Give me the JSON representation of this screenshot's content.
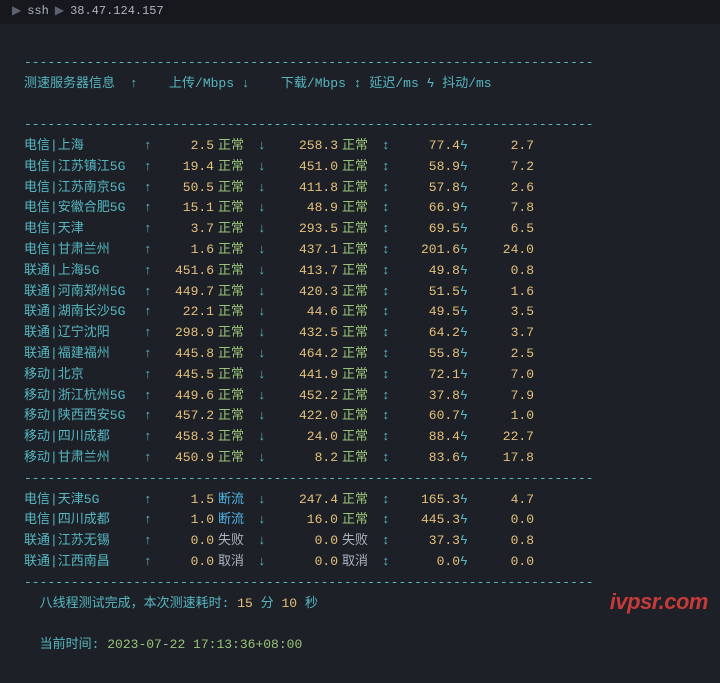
{
  "breadcrumb": {
    "a": "ssh",
    "b": "38.47.124.157",
    "arrow": "▶"
  },
  "divider": "-------------------------------------------------------------------------",
  "header": {
    "server": "测速服务器信息",
    "up": "上传/Mbps",
    "down": "下载/Mbps",
    "latency": "延迟/ms",
    "jitter": "抖动/ms",
    "i_up": "↑",
    "i_dn": "↓",
    "i_ud": "↕",
    "i_spark": "ϟ"
  },
  "icons": {
    "up": "↑",
    "dn": "↓",
    "ud": "↕",
    "spark": "ϟ"
  },
  "rows_main": [
    {
      "srv": "电信|上海",
      "up": "2.5",
      "s1": "正常",
      "dn": "258.3",
      "s2": "正常",
      "lat": "77.4",
      "jit": "2.7"
    },
    {
      "srv": "电信|江苏镇江5G",
      "up": "19.4",
      "s1": "正常",
      "dn": "451.0",
      "s2": "正常",
      "lat": "58.9",
      "jit": "7.2"
    },
    {
      "srv": "电信|江苏南京5G",
      "up": "50.5",
      "s1": "正常",
      "dn": "411.8",
      "s2": "正常",
      "lat": "57.8",
      "jit": "2.6"
    },
    {
      "srv": "电信|安徽合肥5G",
      "up": "15.1",
      "s1": "正常",
      "dn": "48.9",
      "s2": "正常",
      "lat": "66.9",
      "jit": "7.8"
    },
    {
      "srv": "电信|天津",
      "up": "3.7",
      "s1": "正常",
      "dn": "293.5",
      "s2": "正常",
      "lat": "69.5",
      "jit": "6.5"
    },
    {
      "srv": "电信|甘肃兰州",
      "up": "1.6",
      "s1": "正常",
      "dn": "437.1",
      "s2": "正常",
      "lat": "201.6",
      "jit": "24.0"
    },
    {
      "srv": "联通|上海5G",
      "up": "451.6",
      "s1": "正常",
      "dn": "413.7",
      "s2": "正常",
      "lat": "49.8",
      "jit": "0.8"
    },
    {
      "srv": "联通|河南郑州5G",
      "up": "449.7",
      "s1": "正常",
      "dn": "420.3",
      "s2": "正常",
      "lat": "51.5",
      "jit": "1.6"
    },
    {
      "srv": "联通|湖南长沙5G",
      "up": "22.1",
      "s1": "正常",
      "dn": "44.6",
      "s2": "正常",
      "lat": "49.5",
      "jit": "3.5"
    },
    {
      "srv": "联通|辽宁沈阳",
      "up": "298.9",
      "s1": "正常",
      "dn": "432.5",
      "s2": "正常",
      "lat": "64.2",
      "jit": "3.7"
    },
    {
      "srv": "联通|福建福州",
      "up": "445.8",
      "s1": "正常",
      "dn": "464.2",
      "s2": "正常",
      "lat": "55.8",
      "jit": "2.5"
    },
    {
      "srv": "移动|北京",
      "up": "445.5",
      "s1": "正常",
      "dn": "441.9",
      "s2": "正常",
      "lat": "72.1",
      "jit": "7.0"
    },
    {
      "srv": "移动|浙江杭州5G",
      "up": "449.6",
      "s1": "正常",
      "dn": "452.2",
      "s2": "正常",
      "lat": "37.8",
      "jit": "7.9"
    },
    {
      "srv": "移动|陕西西安5G",
      "up": "457.2",
      "s1": "正常",
      "dn": "422.0",
      "s2": "正常",
      "lat": "60.7",
      "jit": "1.0"
    },
    {
      "srv": "移动|四川成都",
      "up": "458.3",
      "s1": "正常",
      "dn": "24.0",
      "s2": "正常",
      "lat": "88.4",
      "jit": "22.7"
    },
    {
      "srv": "移动|甘肃兰州",
      "up": "450.9",
      "s1": "正常",
      "dn": "8.2",
      "s2": "正常",
      "lat": "83.6",
      "jit": "17.8"
    }
  ],
  "rows_sec": [
    {
      "srv": "电信|天津5G",
      "up": "1.5",
      "s1": "断流",
      "s1c": "blue",
      "dn": "247.4",
      "s2": "正常",
      "s2c": "green",
      "lat": "165.3",
      "jit": "4.7"
    },
    {
      "srv": "电信|四川成都",
      "up": "1.0",
      "s1": "断流",
      "s1c": "blue",
      "dn": "16.0",
      "s2": "正常",
      "s2c": "green",
      "lat": "445.3",
      "jit": "0.0"
    },
    {
      "srv": "联通|江苏无锡",
      "up": "0.0",
      "s1": "失败",
      "s1c": "gray",
      "dn": "0.0",
      "s2": "失败",
      "s2c": "gray",
      "lat": "37.3",
      "jit": "0.8"
    },
    {
      "srv": "联通|江西南昌",
      "up": "0.0",
      "s1": "取消",
      "s1c": "gray",
      "dn": "0.0",
      "s2": "取消",
      "s2c": "gray",
      "lat": "0.0",
      "jit": "0.0"
    }
  ],
  "footer": {
    "l1a": "八线程测试完成，本次测速耗时:",
    "l1_min": "15",
    "l1_minu": "分",
    "l1_sec": "10",
    "l1_secu": "秒",
    "l2a": "当前时间:",
    "l2b": "2023-07-22 17:13:36+08:00"
  },
  "watermark": "ivpsr.com"
}
